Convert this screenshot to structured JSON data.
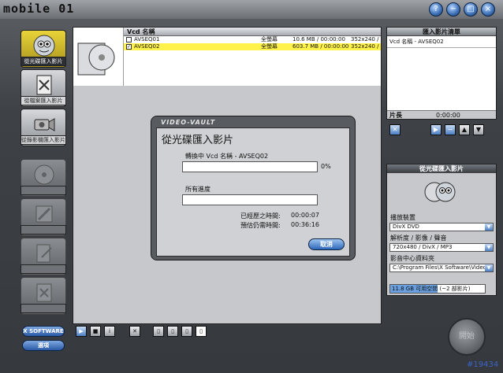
{
  "app": {
    "logo_text": "mobile 01",
    "window_buttons": [
      "?",
      "−",
      "□",
      "×"
    ]
  },
  "sidebar": {
    "items": [
      {
        "label": "從光碟匯入影片",
        "state": "active"
      },
      {
        "label": "從檔案匯入影片",
        "state": "normal"
      },
      {
        "label": "從錄影機匯入影片",
        "state": "normal"
      },
      {
        "label": "",
        "state": "disabled"
      },
      {
        "label": "",
        "state": "disabled"
      },
      {
        "label": "",
        "state": "disabled"
      },
      {
        "label": "",
        "state": "disabled"
      }
    ],
    "software_button": "X SOFTWARE",
    "options_button": "選項"
  },
  "file_table": {
    "header": "Vcd 名稱",
    "rows": [
      {
        "checked": false,
        "name": "AVSEQ01",
        "screen": "全螢幕",
        "size": "10.6 MB / 00:00:00",
        "res": "352x240 /"
      },
      {
        "checked": true,
        "name": "AVSEQ02",
        "screen": "全螢幕",
        "size": "603.7 MB / 00:00:00",
        "res": "352x240 /"
      }
    ]
  },
  "dialog": {
    "brand": "VIDEO-VAULT",
    "title": "從光碟匯入影片",
    "converting_label": "轉換中 Vcd 名稱 - AVSEQ02",
    "converting_percent": "0%",
    "overall_label": "所有進度",
    "elapsed_label": "已經歷之時間:",
    "elapsed_value": "00:00:07",
    "remaining_label": "預估仍需時間:",
    "remaining_value": "00:36:16",
    "cancel_button": "取消"
  },
  "import_list": {
    "title": "匯入影片清單",
    "column": "Vcd 名稱 - AVSEQ02",
    "length_label": "片長",
    "length_value": "0:00:00"
  },
  "settings": {
    "title": "從光碟匯入影片",
    "device_label": "播放裝置",
    "device_value": "DivX DVD",
    "format_label": "解析度 / 影像 / 聲音",
    "format_value": "720x480 / DivX / MP3",
    "library_label": "影音中心資料夾",
    "library_value": "C:\\Program Files\\X Software\\Video",
    "capacity_text": "11.8 GB 可用空間 (~2 部影片)",
    "capacity_fill": 0.5
  },
  "start_button": "開始",
  "watermark": "#19434"
}
